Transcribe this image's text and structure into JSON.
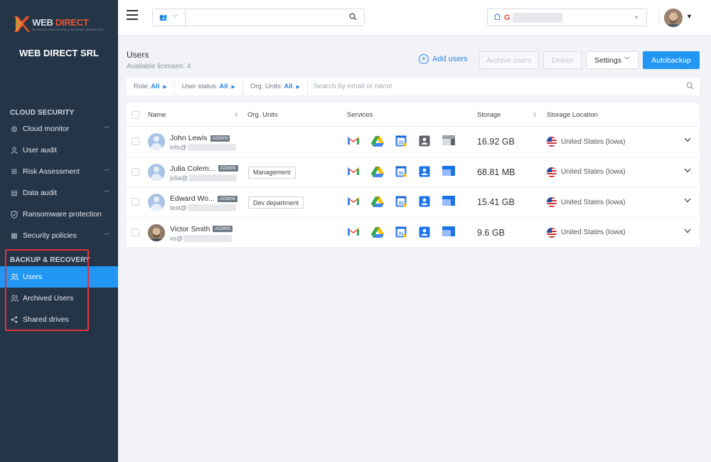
{
  "brand": {
    "logo_word_a": "WEB ",
    "logo_word_b": "DIRECT",
    "logo_tagline": "BUSINESS WEB DESIGN & INTERNET MARKETING",
    "company": "WEB DIRECT SRL"
  },
  "sidebar": {
    "cloud_title": "CLOUD SECURITY",
    "cloud_items": [
      {
        "label": "Cloud monitor",
        "icon": "globe-icon",
        "expandable": true
      },
      {
        "label": "User audit",
        "icon": "user-icon",
        "expandable": false
      },
      {
        "label": "Risk Assessment",
        "icon": "grid-icon",
        "expandable": true
      },
      {
        "label": "Data audit",
        "icon": "document-icon",
        "expandable": true
      },
      {
        "label": "Ransomware protection",
        "icon": "shield-icon",
        "expandable": false
      },
      {
        "label": "Security policies",
        "icon": "policy-icon",
        "expandable": true
      }
    ],
    "backup_title": "BACKUP & RECOVERY",
    "backup_items": [
      {
        "label": "Users",
        "icon": "users-icon",
        "active": true
      },
      {
        "label": "Archived Users",
        "icon": "users-icon",
        "active": false
      },
      {
        "label": "Shared drives",
        "icon": "share-icon",
        "active": false
      }
    ]
  },
  "topbar": {
    "search_placeholder": "",
    "home_icon": "home-icon",
    "google_icon": "G"
  },
  "header": {
    "title": "Users",
    "licenses": "Available licenses: 4",
    "add_users": "Add users",
    "archive_users": "Archive users",
    "delete": "Delete",
    "settings": "Settings",
    "autobackup": "Autobackup"
  },
  "filters": {
    "role_label": "Role:",
    "role_value": "All",
    "status_label": "User status:",
    "status_value": "All",
    "org_label": "Org. Units:",
    "org_value": "All",
    "search_placeholder": "Search by email or name"
  },
  "table": {
    "columns": {
      "name": "Name",
      "org_units": "Org. Units",
      "services": "Services",
      "storage": "Storage",
      "location": "Storage Location"
    },
    "rows": [
      {
        "name": "John Lewis",
        "badge": "ADMIN",
        "email": "info@",
        "org_unit": "",
        "storage": "16.92 GB",
        "location": "United States (Iowa)",
        "photo": false
      },
      {
        "name": "Julia Colem...",
        "badge": "ADMIN",
        "email": "julia@",
        "org_unit": "Management",
        "storage": "68.81 MB",
        "location": "United States (Iowa)",
        "photo": false
      },
      {
        "name": "Edward Wo...",
        "badge": "ADMIN",
        "email": "test@",
        "org_unit": "Dev department",
        "storage": "15.41 GB",
        "location": "United States (Iowa)",
        "photo": false
      },
      {
        "name": "Victor Smith",
        "badge": "ADMIN",
        "email": "vs@",
        "org_unit": "",
        "storage": "9.6 GB",
        "location": "United States (Iowa)",
        "photo": true
      }
    ]
  },
  "colors": {
    "sidebar": "#253548",
    "accent": "#2196f3",
    "highlight_box": "#e0313f"
  }
}
